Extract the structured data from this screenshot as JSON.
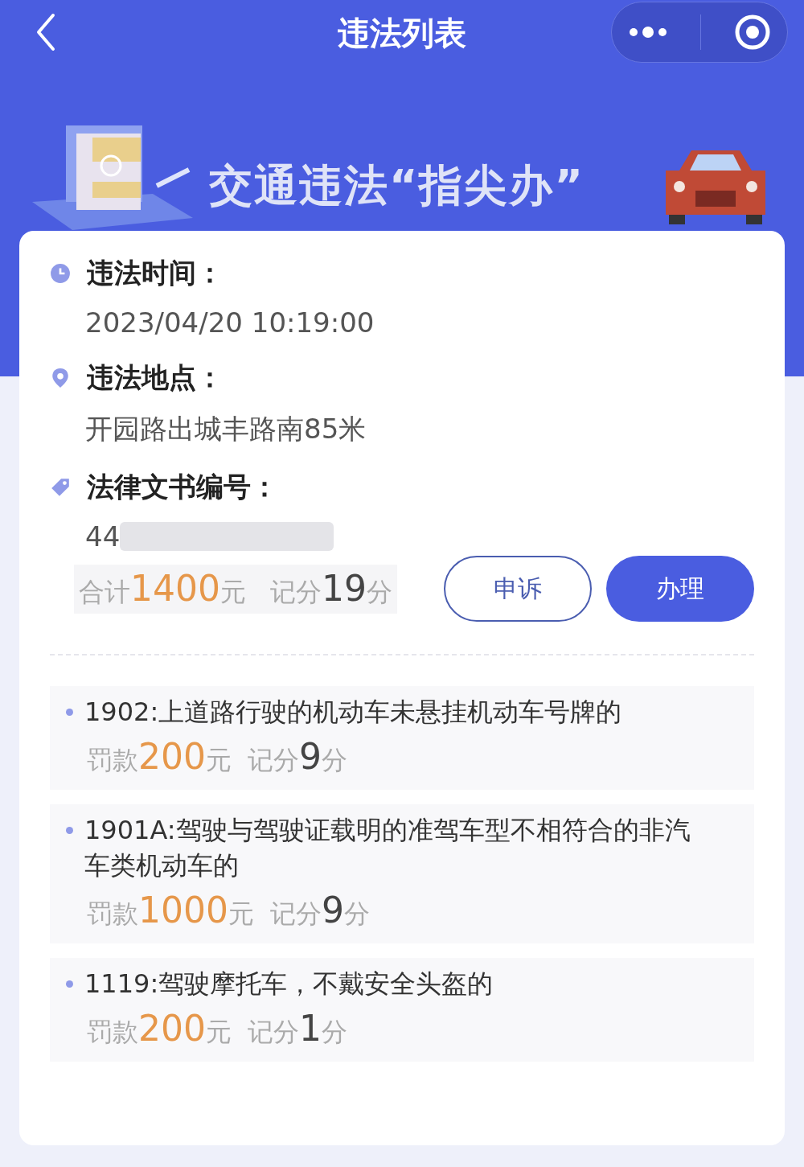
{
  "nav": {
    "title": "违法列表"
  },
  "banner": {
    "headline": "交通违法“指尖办”"
  },
  "details": [
    {
      "kind": "time",
      "label": "违法时间：",
      "value": "2023/04/20 10:19:00"
    },
    {
      "kind": "place",
      "label": "违法地点：",
      "value": "开园路出城丰路南85米"
    },
    {
      "kind": "document",
      "label": "法律文书编号：",
      "value": "44"
    }
  ],
  "summary": {
    "total_label": "合计",
    "total": "1400",
    "total_unit": "元",
    "points_label": "记分",
    "points": "19",
    "points_unit": "分"
  },
  "buttons": [
    {
      "label": "申诉",
      "kind": "outline"
    },
    {
      "label": "办理",
      "kind": "primary"
    }
  ],
  "violations": [
    {
      "title": "1902:上道路行驶的机动车未悬挂机动车号牌的",
      "fine_label": "罚款",
      "fine": "200",
      "fine_unit": "元",
      "points_label": "记分",
      "points": "9",
      "points_unit": "分"
    },
    {
      "title": "1901A:驾驶与驾驶证载明的准驾车型不相符合的非汽车类机动车的",
      "fine_label": "罚款",
      "fine": "1000",
      "fine_unit": "元",
      "points_label": "记分",
      "points": "9",
      "points_unit": "分"
    },
    {
      "title": "1119:驾驶摩托车，不戴安全头盔的",
      "fine_label": "罚款",
      "fine": "200",
      "fine_unit": "元",
      "points_label": "记分",
      "points": "1",
      "points_unit": "分"
    }
  ]
}
